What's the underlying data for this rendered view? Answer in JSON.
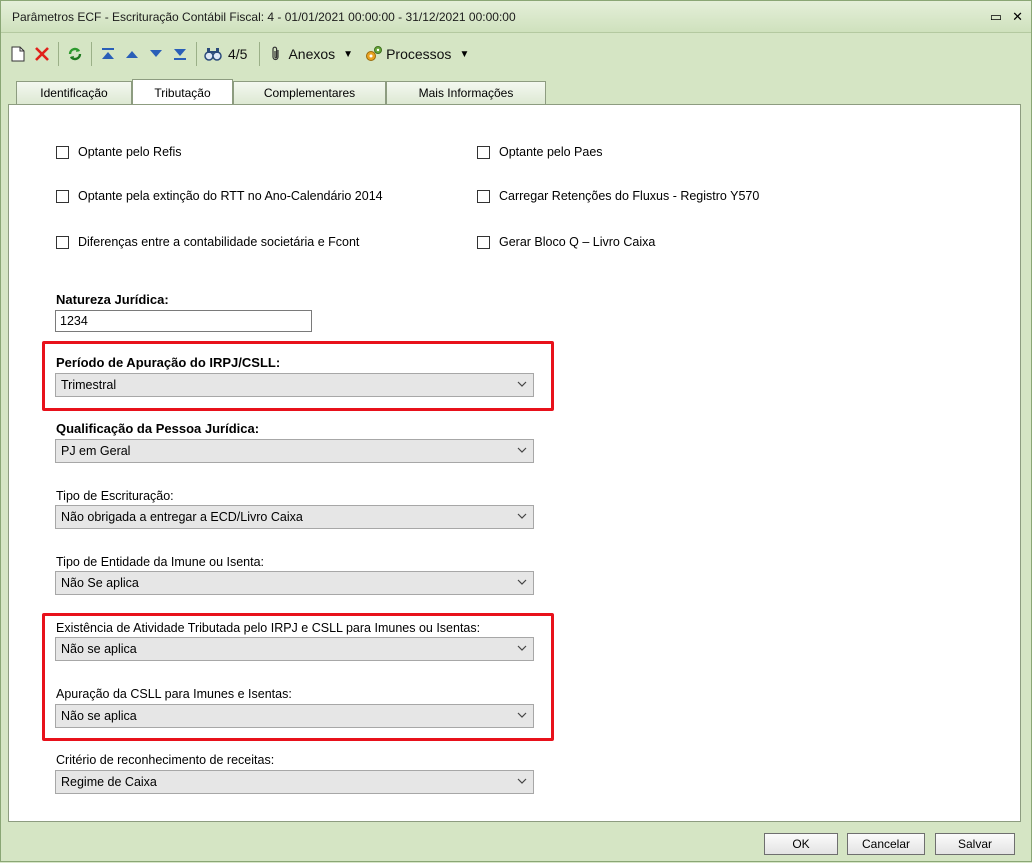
{
  "window": {
    "title": "Parâmetros ECF - Escrituração Contábil Fiscal: 4 - 01/01/2021 00:00:00 - 31/12/2021 00:00:00",
    "restore_glyph": "▭",
    "close_glyph": "✕"
  },
  "toolbar": {
    "record_counter": "4/5",
    "attachments_label": "Anexos",
    "processes_label": "Processos",
    "icons": [
      "new-icon",
      "delete-icon",
      "refresh-icon",
      "first-icon",
      "prev-icon",
      "next-icon",
      "last-icon",
      "find-icon",
      "paperclip-icon",
      "gears-icon"
    ]
  },
  "tabs": [
    "Identificação",
    "Tributação",
    "Complementares",
    "Mais Informações"
  ],
  "active_tab": "Tributação",
  "checkboxes": {
    "refis": "Optante pelo Refis",
    "paes": "Optante pelo Paes",
    "rtt": "Optante pela extinção do RTT no Ano-Calendário 2014",
    "fluxus": "Carregar Retenções do Fluxus - Registro Y570",
    "diferencas": "Diferenças entre a contabilidade societária e Fcont",
    "bloco_q": "Gerar Bloco Q – Livro Caixa"
  },
  "fields": {
    "natureza": {
      "label": "Natureza Jurídica:",
      "value": "1234"
    },
    "periodo": {
      "label": "Período de Apuração do IRPJ/CSLL:",
      "value": "Trimestral"
    },
    "qualificacao": {
      "label": "Qualificação da Pessoa Jurídica:",
      "value": "PJ em Geral"
    },
    "tipo_escrituracao": {
      "label": "Tipo de Escrituração:",
      "value": "Não obrigada a entregar a ECD/Livro Caixa"
    },
    "tipo_entidade": {
      "label": "Tipo de Entidade da Imune ou Isenta:",
      "value": "Não Se aplica"
    },
    "existencia_atividade": {
      "label": "Existência de Atividade Tributada pelo IRPJ e CSLL para Imunes ou Isentas:",
      "value": "Não se aplica"
    },
    "apuracao_csll": {
      "label": "Apuração da CSLL para Imunes e Isentas:",
      "value": "Não se aplica"
    },
    "criterio_receitas": {
      "label": "Critério de reconhecimento de receitas:",
      "value": "Regime de Caixa"
    }
  },
  "buttons": {
    "ok": "OK",
    "cancel": "Cancelar",
    "save": "Salvar"
  },
  "colors": {
    "highlight": "#e8111b",
    "window_bg": "#d5e5c4"
  }
}
